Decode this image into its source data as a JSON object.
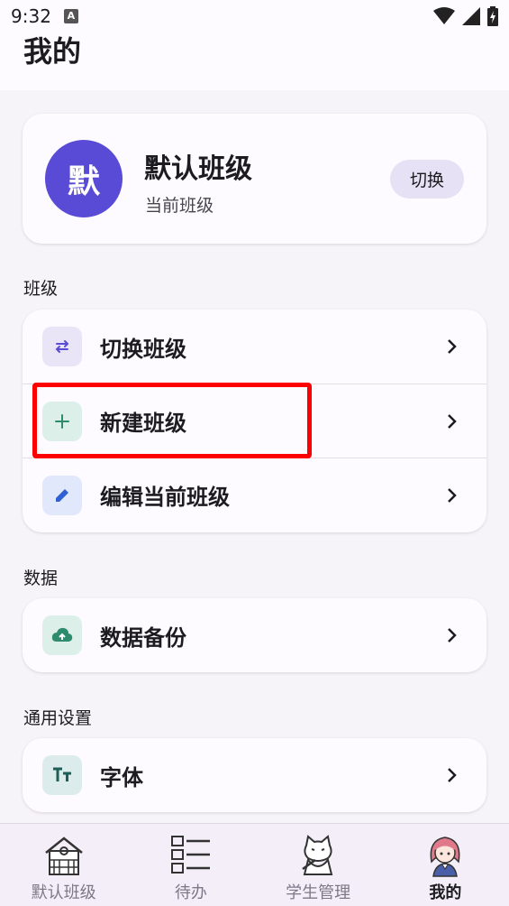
{
  "status_bar": {
    "time": "9:32",
    "notification_icon": "A"
  },
  "header": {
    "title": "我的"
  },
  "current_class": {
    "avatar_text": "默",
    "name": "默认班级",
    "subtitle": "当前班级",
    "switch_label": "切换"
  },
  "sections": {
    "class": {
      "title": "班级",
      "items": [
        {
          "label": "切换班级",
          "icon": "swap-icon"
        },
        {
          "label": "新建班级",
          "icon": "plus-icon"
        },
        {
          "label": "编辑当前班级",
          "icon": "pencil-icon"
        }
      ]
    },
    "data": {
      "title": "数据",
      "items": [
        {
          "label": "数据备份",
          "icon": "cloud-upload-icon"
        }
      ]
    },
    "general": {
      "title": "通用设置",
      "items": [
        {
          "label": "字体",
          "icon": "font-size-icon"
        }
      ]
    }
  },
  "bottom_nav": {
    "items": [
      {
        "label": "默认班级",
        "icon": "school-building-icon"
      },
      {
        "label": "待办",
        "icon": "todo-list-icon"
      },
      {
        "label": "学生管理",
        "icon": "cat-student-icon"
      },
      {
        "label": "我的",
        "icon": "girl-avatar-icon",
        "active": true
      }
    ]
  },
  "colors": {
    "accent": "#5a4bd6",
    "highlight": "#ff0000"
  }
}
